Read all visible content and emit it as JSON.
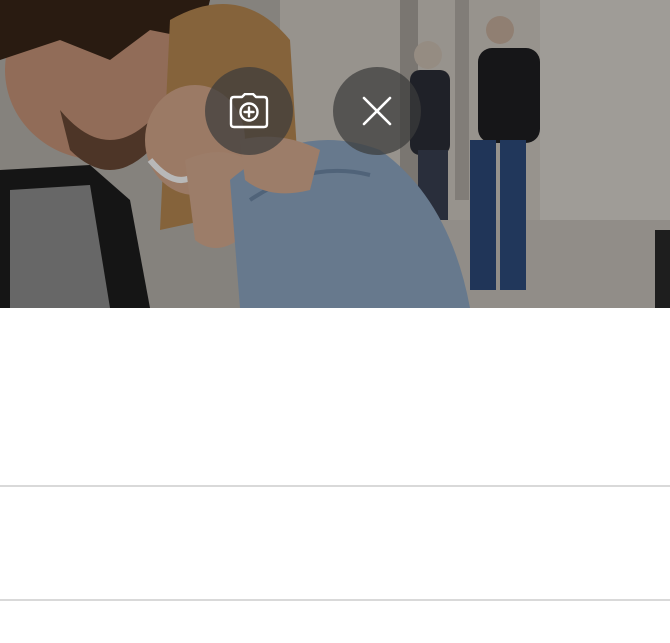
{
  "cover": {
    "photo_description_icon": "couple-photo",
    "actions": {
      "add_photo_icon": "camera-plus-icon",
      "remove_icon": "close-icon"
    }
  },
  "colors": {
    "overlay_button": "#3c3c3c",
    "icon": "#ffffff",
    "divider": "#d9d9d9",
    "background": "#ffffff"
  }
}
